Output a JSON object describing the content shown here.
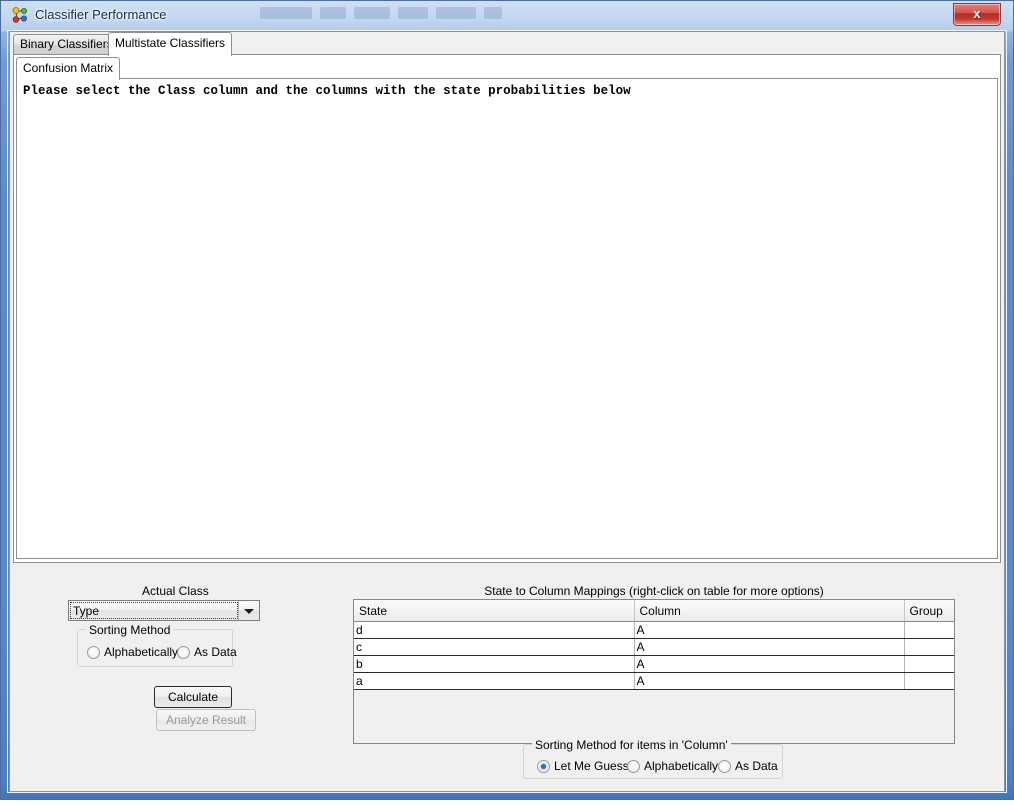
{
  "window": {
    "title": "Classifier Performance",
    "icon": "network-nodes-icon",
    "close_label": "x"
  },
  "outer_tabs": [
    {
      "label": "Binary Classifiers",
      "active": false
    },
    {
      "label": "Multistate Classifiers",
      "active": true
    }
  ],
  "inner_tabs": [
    {
      "label": "Confusion Matrix",
      "active": true
    }
  ],
  "content": {
    "instruction": "Please select the Class column and the columns with the state probabilities below"
  },
  "actual_class": {
    "label": "Actual Class",
    "combo_value": "Type",
    "combo_placeholder": "Type",
    "sorting_group_title": "Sorting Method",
    "sorting_options": [
      {
        "label": "Alphabetically",
        "checked": false
      },
      {
        "label": "As Data",
        "checked": false
      }
    ]
  },
  "buttons": {
    "calculate": "Calculate",
    "analyze_result": "Analyze Result"
  },
  "mappings": {
    "title": "State to Column Mappings (right-click on table for more options)",
    "columns": [
      "State",
      "Column",
      "Group"
    ],
    "rows": [
      {
        "state": "d",
        "column": "A",
        "group": ""
      },
      {
        "state": "c",
        "column": "A",
        "group": ""
      },
      {
        "state": "b",
        "column": "A",
        "group": ""
      },
      {
        "state": "a",
        "column": "A",
        "group": ""
      }
    ]
  },
  "column_sorting": {
    "group_title": "Sorting Method for items in 'Column'",
    "options": [
      {
        "label": "Let Me Guess",
        "checked": true
      },
      {
        "label": "Alphabetically",
        "checked": false
      },
      {
        "label": "As Data",
        "checked": false
      }
    ]
  },
  "colors": {
    "accent": "#2e6fbe",
    "frame": "#5a8bd0",
    "close_button": "#b62b24",
    "client_bg": "#f0f0f0",
    "content_bg": "#ffffff"
  }
}
